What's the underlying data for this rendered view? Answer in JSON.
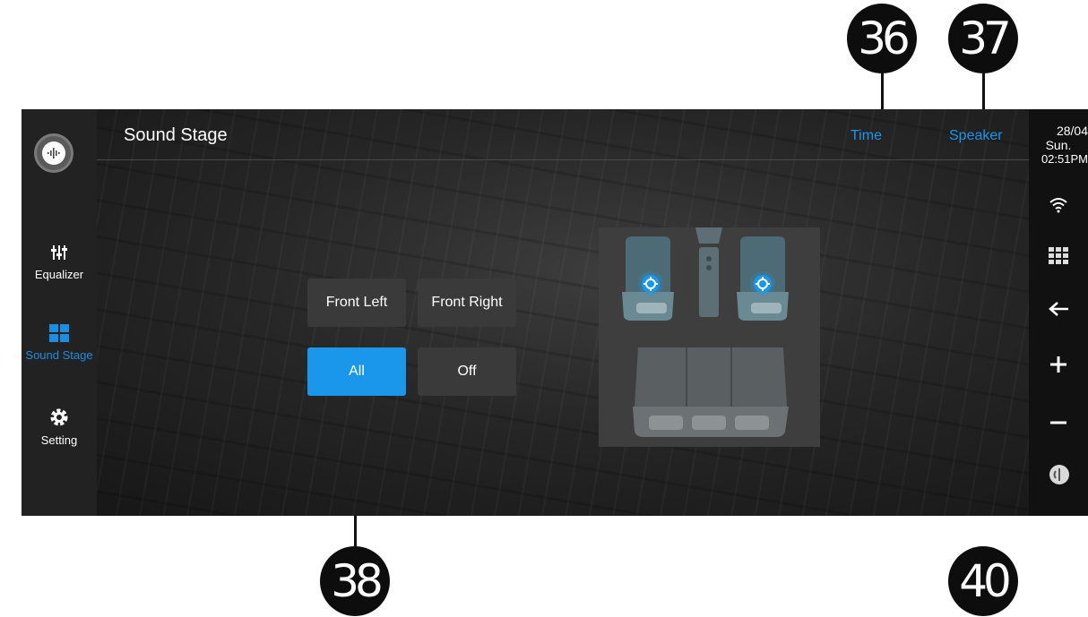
{
  "callouts": {
    "time": "36",
    "speaker": "37",
    "all_button": "38",
    "right_bar": "40"
  },
  "nav": {
    "items": [
      {
        "label": "Equalizer",
        "icon": "equalizer-sliders-icon"
      },
      {
        "label": "Sound Stage",
        "icon": "sound-stage-grid-icon",
        "active": true
      },
      {
        "label": "Setting",
        "icon": "gear-icon"
      }
    ]
  },
  "header": {
    "title": "Sound Stage",
    "tabs": [
      "Time",
      "Speaker"
    ]
  },
  "status": {
    "date": "28/04",
    "weekday": "Sun.",
    "time": "02:51PM"
  },
  "buttons": {
    "front_left": "Front Left",
    "front_right": "Front Right",
    "all": "All",
    "off": "Off",
    "selected": "all"
  },
  "right_icons": [
    "wifi-icon",
    "apps-grid-icon",
    "back-arrow-icon",
    "volume-up-icon",
    "volume-down-icon",
    "power-icon"
  ],
  "colors": {
    "accent": "#1a97ea",
    "button_bg": "#3a3a3a",
    "nav_bg": "#222222"
  }
}
